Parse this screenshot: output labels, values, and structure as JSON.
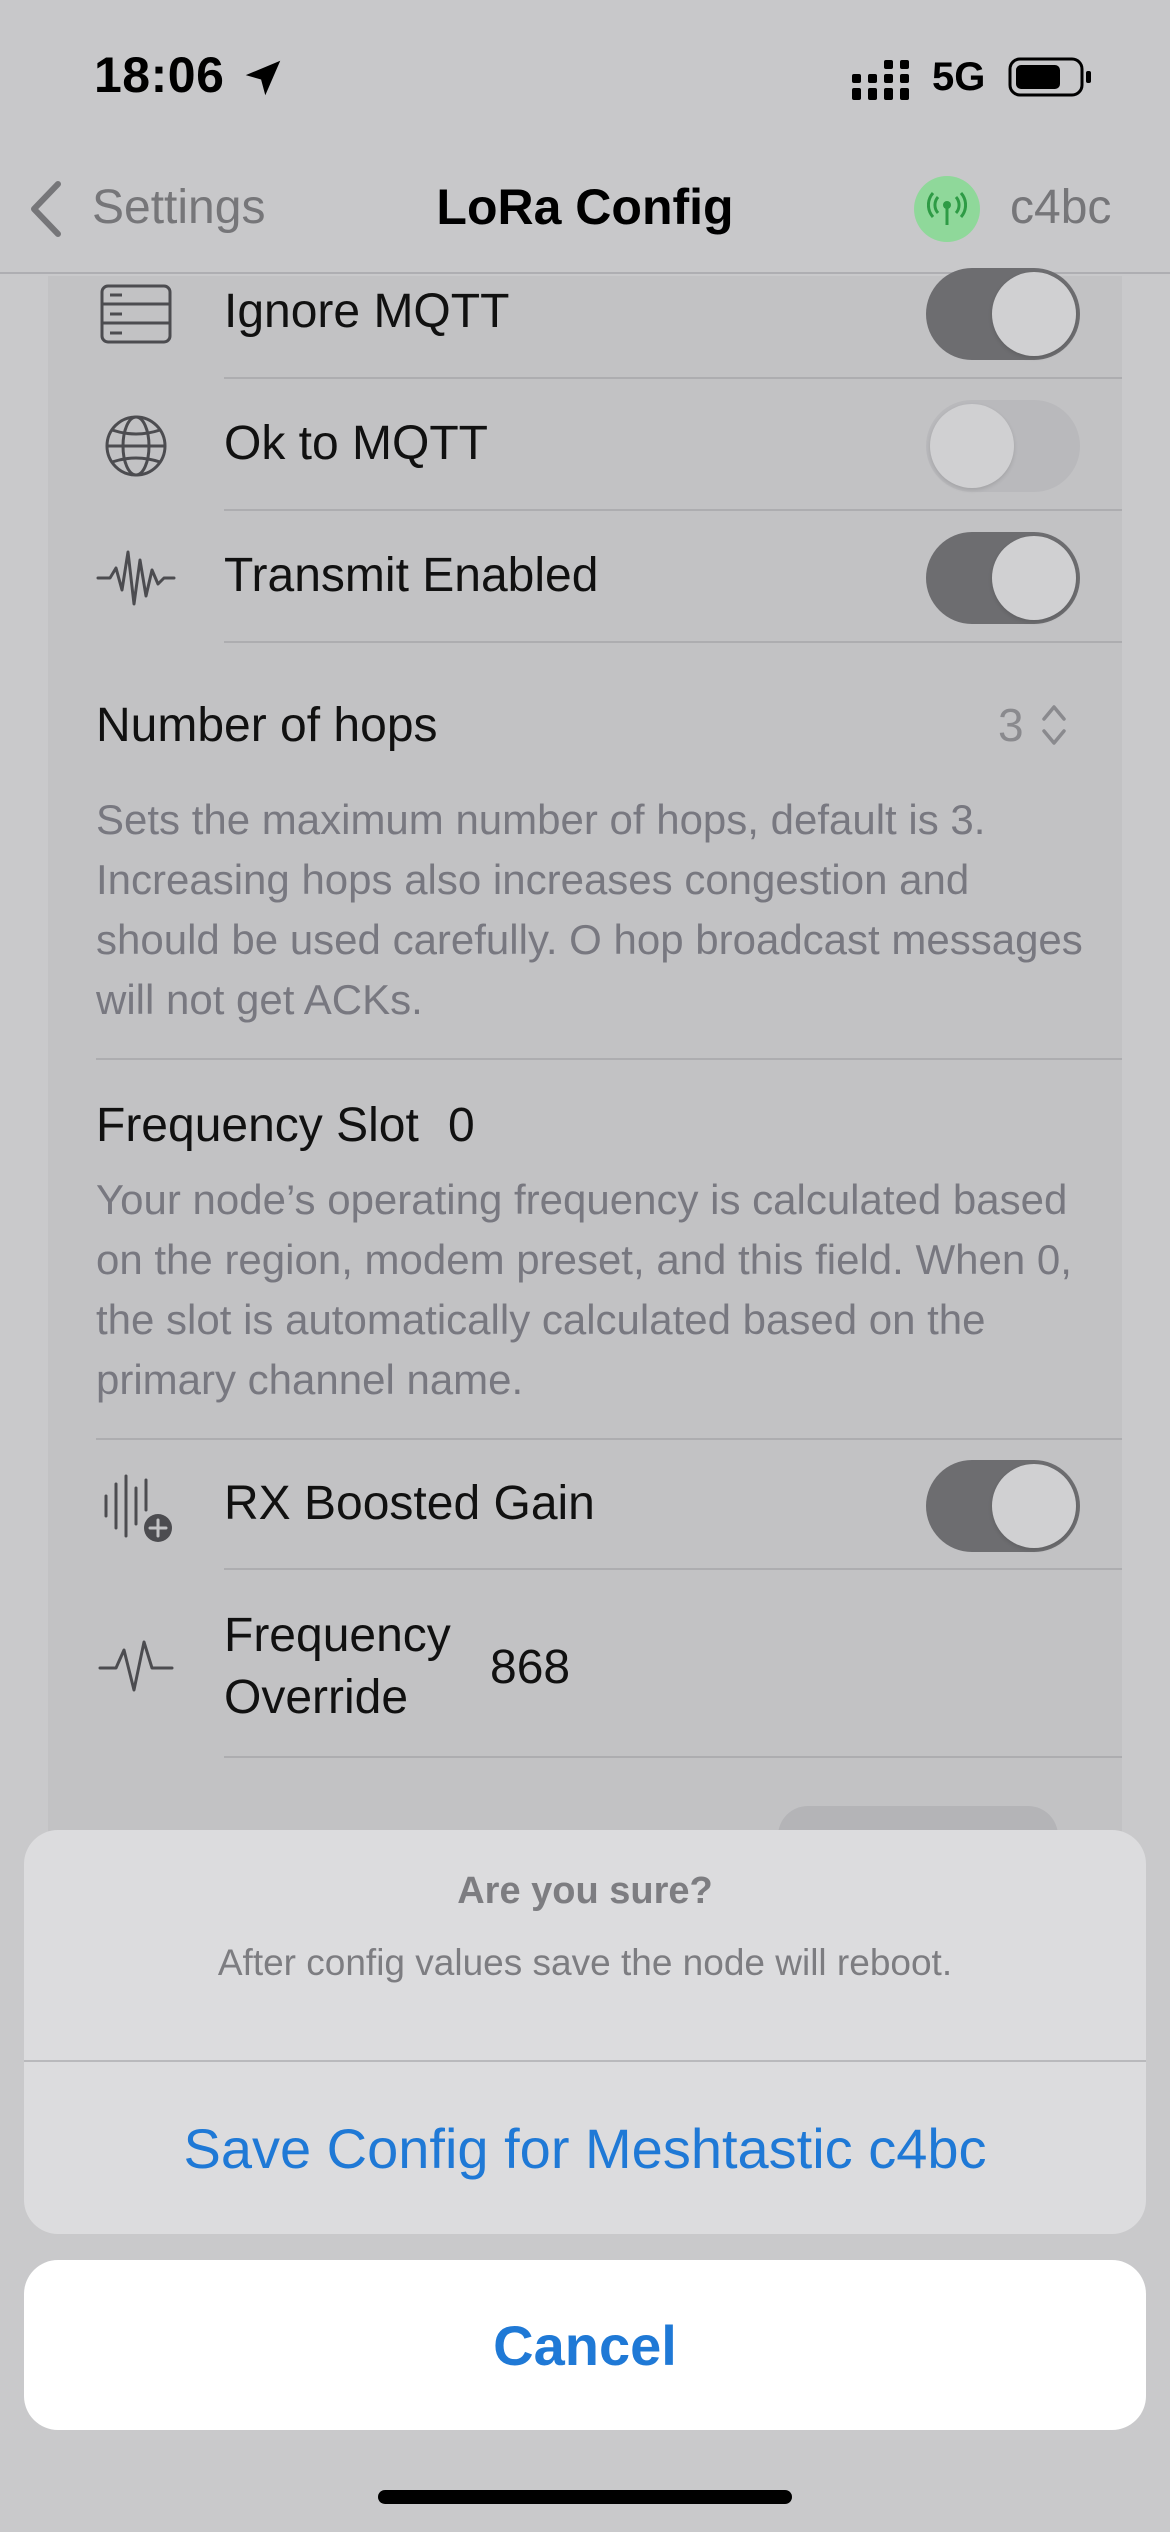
{
  "status_bar": {
    "time": "18:06",
    "network": "5G",
    "icons": [
      "location-arrow-icon",
      "cellular-signal-icon",
      "battery-icon"
    ]
  },
  "nav": {
    "back_label": "Settings",
    "title": "LoRa Config",
    "node_short_name": "c4bc",
    "node_icon": "antenna-icon"
  },
  "settings": {
    "ignore_mqtt": {
      "label": "Ignore MQTT",
      "icon": "server-icon",
      "on": true
    },
    "ok_to_mqtt": {
      "label": "Ok to MQTT",
      "icon": "globe-icon",
      "on": false
    },
    "transmit_enabled": {
      "label": "Transmit Enabled",
      "icon": "waveform-icon",
      "on": true
    },
    "hops": {
      "label": "Number of hops",
      "value": "3",
      "description": "Sets the maximum number of hops, default is 3. Increasing hops also increases congestion and should be used carefully. O hop broadcast messages will not get ACKs."
    },
    "frequency_slot": {
      "label": "Frequency Slot",
      "value": "0",
      "description": "Your node’s operating frequency is calculated based on the region, modem preset, and this field. When 0, the slot is automatically calculated based on the primary channel name."
    },
    "rx_boosted_gain": {
      "label": "RX Boosted Gain",
      "icon": "waveform-plus-icon",
      "on": true
    },
    "frequency_override": {
      "label_line1": "Frequency",
      "label_line2": "Override",
      "value": "868",
      "icon": "waveform-path-icon"
    }
  },
  "action_sheet": {
    "title": "Are you sure?",
    "message": "After config values save the node will reboot.",
    "confirm_label": "Save Config for Meshtastic c4bc",
    "cancel_label": "Cancel"
  },
  "colors": {
    "accent": "#1f79d6",
    "toggle_on": "#6d6d70",
    "node_badge": "#8fd89a"
  }
}
